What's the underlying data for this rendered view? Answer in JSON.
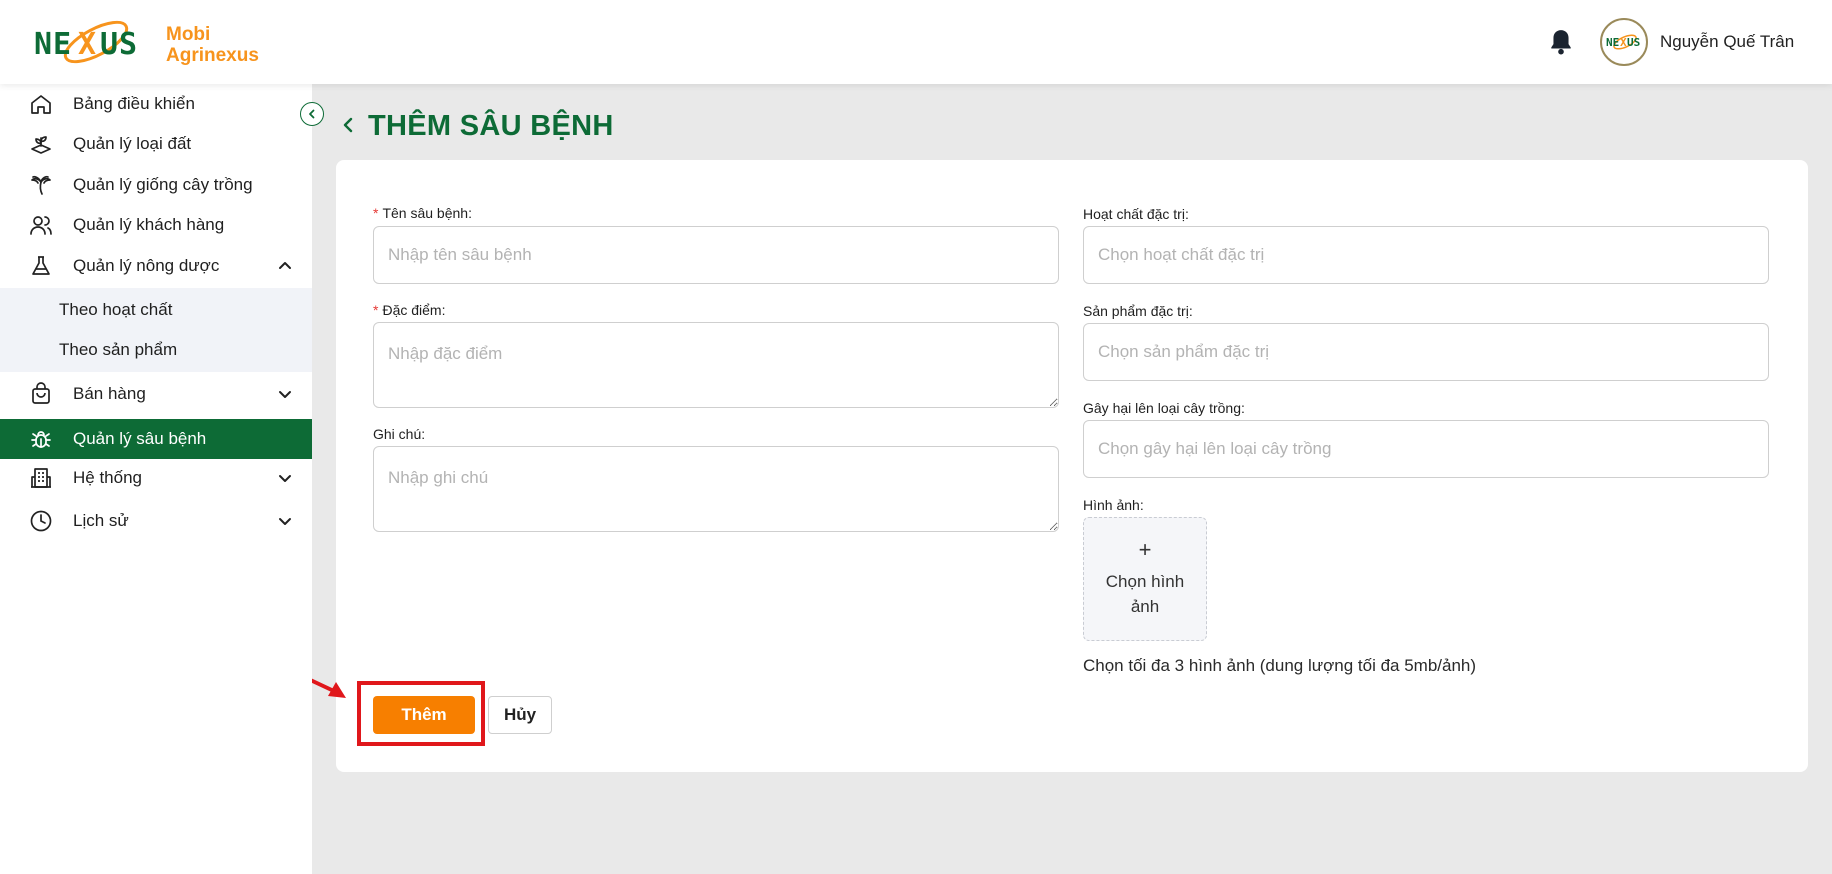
{
  "app": {
    "logo_text": "NEXUS",
    "brand_line1": "Mobi",
    "brand_line2": "Agrinexus",
    "avatar_text": "NEXUS",
    "user_name": "Nguyễn Quế Trân"
  },
  "sidebar": {
    "items": [
      {
        "label": "Bảng điều khiển",
        "icon": "home-icon"
      },
      {
        "label": "Quản lý loại đất",
        "icon": "soil-sprout-icon"
      },
      {
        "label": "Quản lý giống cây trồng",
        "icon": "palm-tree-icon"
      },
      {
        "label": "Quản lý khách hàng",
        "icon": "users-icon"
      },
      {
        "label": "Quản lý nông dược",
        "icon": "flask-icon",
        "expanded": true
      },
      {
        "label": "Bán hàng",
        "icon": "shopping-bag-icon"
      },
      {
        "label": "Quản lý sâu bệnh",
        "icon": "bug-icon",
        "active": true
      },
      {
        "label": "Hệ thống",
        "icon": "building-icon"
      },
      {
        "label": "Lịch sử",
        "icon": "clock-icon"
      }
    ],
    "subitems": [
      {
        "label": "Theo hoạt chất"
      },
      {
        "label": "Theo sản phẩm"
      }
    ]
  },
  "page": {
    "title": "THÊM SÂU BỆNH"
  },
  "form": {
    "pest_name": {
      "label": "Tên sâu bệnh:",
      "placeholder": "Nhập tên sâu bệnh",
      "required": true
    },
    "characteristics": {
      "label": "Đặc điểm:",
      "placeholder": "Nhập đặc điểm",
      "required": true
    },
    "notes": {
      "label": "Ghi chú:",
      "placeholder": "Nhập ghi chú"
    },
    "active_ingredient": {
      "label": "Hoạt chất đặc trị:",
      "placeholder": "Chọn hoạt chất đặc trị"
    },
    "treatment_product": {
      "label": "Sản phẩm đặc trị:",
      "placeholder": "Chọn sản phẩm đặc trị"
    },
    "crop_damage": {
      "label": "Gây hại lên loại cây trồng:",
      "placeholder": "Chọn gây hại lên loại cây trồng"
    },
    "images": {
      "label": "Hình ảnh:",
      "plus": "+",
      "upload_text": "Chọn hình ảnh",
      "hint": "Chọn tối đa 3 hình ảnh (dung lượng tối đa 5mb/ảnh)"
    },
    "submit_label": "Thêm",
    "cancel_label": "Hủy"
  },
  "colors": {
    "brand_green": "#0d6b36",
    "brand_orange": "#f7941d",
    "primary_button": "#f77f00",
    "annotation_red": "#e0171b"
  }
}
